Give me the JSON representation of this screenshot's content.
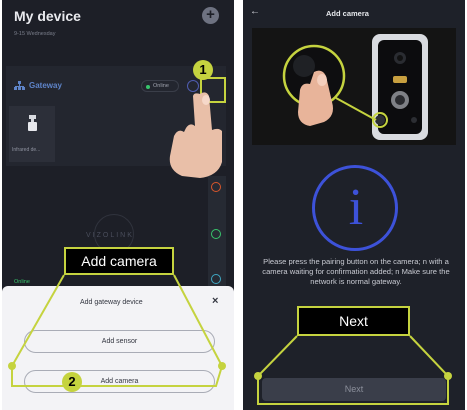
{
  "left_screen": {
    "title": "My device",
    "date": "9-15 Wednesday",
    "add_icon": "plus-icon",
    "gateway": {
      "title": "Gateway",
      "status": "Online",
      "icon": "gateway-icon",
      "settings_icon": "gear-icon"
    },
    "device_tile": {
      "label": "Infrared de...",
      "icon": "camera-icon"
    },
    "watermark": "VIZOLINK",
    "bottom_status": "Online",
    "sheet": {
      "title": "Add gateway device",
      "close_label": "×",
      "buttons": [
        {
          "label": "Add sensor"
        },
        {
          "label": "Add camera"
        }
      ]
    }
  },
  "right_screen": {
    "back_label": "←",
    "title": "Add camera",
    "info_label": "i",
    "instructions": "Please press the pairing button on the camera; n with a camera waiting for confirmation added; n Make sure the network is normal gateway.",
    "next_label": "Next"
  },
  "annotations": {
    "callout_add": "Add camera",
    "callout_next": "Next",
    "step_1": "1",
    "step_2": "2"
  },
  "colors": {
    "accent_highlight": "#c5d33f",
    "info_blue": "#3d52d9",
    "online_green": "#38c46c",
    "dark_bg": "#1d1f27"
  }
}
